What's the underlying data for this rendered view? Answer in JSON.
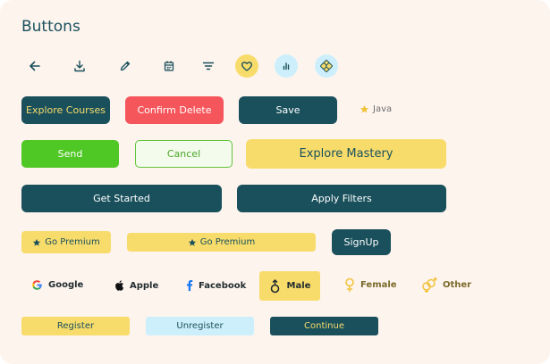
{
  "title": "Buttons",
  "icon_buttons": [
    {
      "icon": "arrow-left-icon"
    },
    {
      "icon": "download-icon"
    },
    {
      "icon": "pencil-icon"
    },
    {
      "icon": "calendar-icon"
    },
    {
      "icon": "filter-icon"
    },
    {
      "icon": "heart-icon"
    },
    {
      "icon": "bar-chart-icon"
    },
    {
      "icon": "clover-icon"
    }
  ],
  "row1": {
    "explore_courses": "Explore Courses",
    "confirm_delete": "Confirm Delete",
    "save": "Save",
    "java": "Java"
  },
  "row2": {
    "send": "Send",
    "cancel": "Cancel",
    "explore_mastery": "Explore Mastery"
  },
  "row3": {
    "get_started": "Get Started",
    "apply_filters": "Apply Filters"
  },
  "row4": {
    "go_premium_small": "Go Premium",
    "go_premium_wide": "Go Premium",
    "signup": "SignUp"
  },
  "row5": {
    "google": "Google",
    "apple": "Apple",
    "facebook": "Facebook",
    "male": "Male",
    "female": "Female",
    "other": "Other"
  },
  "row6": {
    "register": "Register",
    "unregister": "Unregister",
    "continue": "Continue"
  },
  "colors": {
    "background": "#fef4ee",
    "primary_dark": "#19505c",
    "accent_yellow": "#f8dc6b",
    "danger_red": "#f5565b",
    "success_green": "#4fc725",
    "light_blue": "#cdeffb"
  }
}
